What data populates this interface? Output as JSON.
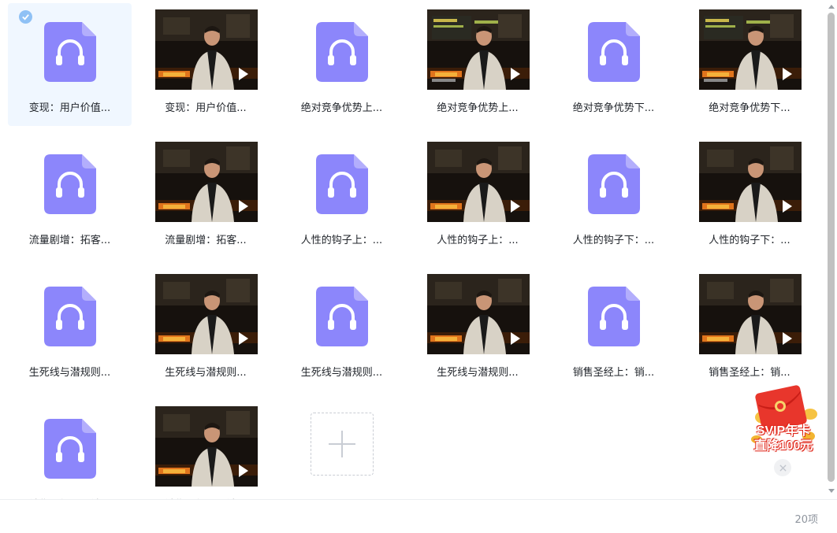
{
  "files": [
    {
      "type": "audio",
      "name": "变现：用户价值...",
      "selected": true
    },
    {
      "type": "video",
      "name": "变现：用户价值...",
      "scene": "a"
    },
    {
      "type": "audio",
      "name": "绝对竞争优势上..."
    },
    {
      "type": "video",
      "name": "绝对竞争优势上...",
      "scene": "b"
    },
    {
      "type": "audio",
      "name": "绝对竞争优势下..."
    },
    {
      "type": "video",
      "name": "绝对竞争优势下...",
      "scene": "b"
    },
    {
      "type": "audio",
      "name": "流量剧增：拓客..."
    },
    {
      "type": "video",
      "name": "流量剧增：拓客...",
      "scene": "c"
    },
    {
      "type": "audio",
      "name": "人性的钩子上：..."
    },
    {
      "type": "video",
      "name": "人性的钩子上：...",
      "scene": "c"
    },
    {
      "type": "audio",
      "name": "人性的钩子下：..."
    },
    {
      "type": "video",
      "name": "人性的钩子下：...",
      "scene": "c"
    },
    {
      "type": "audio",
      "name": "生死线与潜规则..."
    },
    {
      "type": "video",
      "name": "生死线与潜规则...",
      "scene": "c"
    },
    {
      "type": "audio",
      "name": "生死线与潜规则..."
    },
    {
      "type": "video",
      "name": "生死线与潜规则...",
      "scene": "c"
    },
    {
      "type": "audio",
      "name": "销售圣经上：销..."
    },
    {
      "type": "video",
      "name": "销售圣经上：销...",
      "scene": "c"
    },
    {
      "type": "audio",
      "name": "销售圣经下：销..."
    },
    {
      "type": "video",
      "name": "销售圣经下：销...",
      "scene": "c"
    }
  ],
  "upload": {
    "label": "上传文件"
  },
  "footer": {
    "count": "20项"
  },
  "promo": {
    "line1": "SVIP年卡",
    "line2": "直降100元"
  },
  "colors": {
    "audio_icon": "#8c86fb",
    "selected_bg": "#f0f7ff",
    "check": "#8fc1f5",
    "promo_red": "#e0281c"
  },
  "icons": {
    "audio": "headphones-icon",
    "check": "check-icon",
    "play": "play-icon",
    "upload": "plus-icon",
    "close": "close-icon"
  }
}
